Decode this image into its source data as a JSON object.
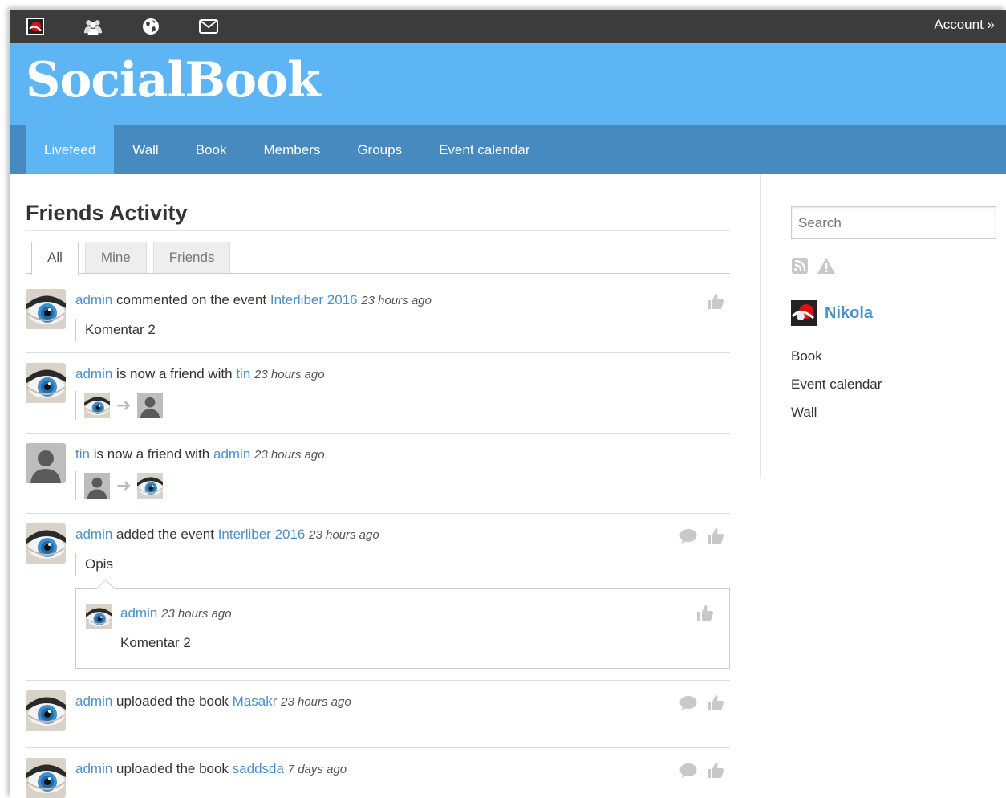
{
  "topbar": {
    "account_label": "Account »"
  },
  "brand": {
    "name": "SocialBook"
  },
  "nav": {
    "items": [
      "Livefeed",
      "Wall",
      "Book",
      "Members",
      "Groups",
      "Event calendar"
    ]
  },
  "main": {
    "title": "Friends Activity",
    "tabs": [
      "All",
      "Mine",
      "Friends"
    ],
    "feed": [
      {
        "actor": "admin",
        "action": " commented on the event ",
        "target": "Interliber 2016",
        "time": "23 hours ago",
        "body": "Komentar 2"
      },
      {
        "actor": "admin",
        "action": " is now a friend with ",
        "target": "tin",
        "time": "23 hours ago"
      },
      {
        "actor": "tin",
        "action": " is now a friend with ",
        "target": "admin",
        "time": "23 hours ago"
      },
      {
        "actor": "admin",
        "action": " added the event ",
        "target": "Interliber 2016",
        "time": "23 hours ago",
        "body": "Opis",
        "comment": {
          "author": "admin",
          "time": "23 hours ago",
          "text": "Komentar 2"
        }
      },
      {
        "actor": "admin",
        "action": " uploaded the book ",
        "target": "Masakr",
        "time": "23 hours ago"
      },
      {
        "actor": "admin",
        "action": " uploaded the book ",
        "target": "saddsda",
        "time": "7 days ago"
      }
    ]
  },
  "sidebar": {
    "search_placeholder": "Search",
    "user_name": "Nikola",
    "links": [
      "Book",
      "Event calendar",
      "Wall"
    ]
  },
  "colors": {
    "banner": "#5db5f4",
    "nav": "#478ac0",
    "topbar": "#3c3c3c",
    "link": "#4a90c9"
  },
  "icons": [
    "site-logo-icon",
    "members-icon",
    "globe-icon",
    "mail-icon",
    "rss-icon",
    "warning-icon",
    "thumbs-up-icon",
    "comment-icon",
    "arrow-right-icon"
  ]
}
